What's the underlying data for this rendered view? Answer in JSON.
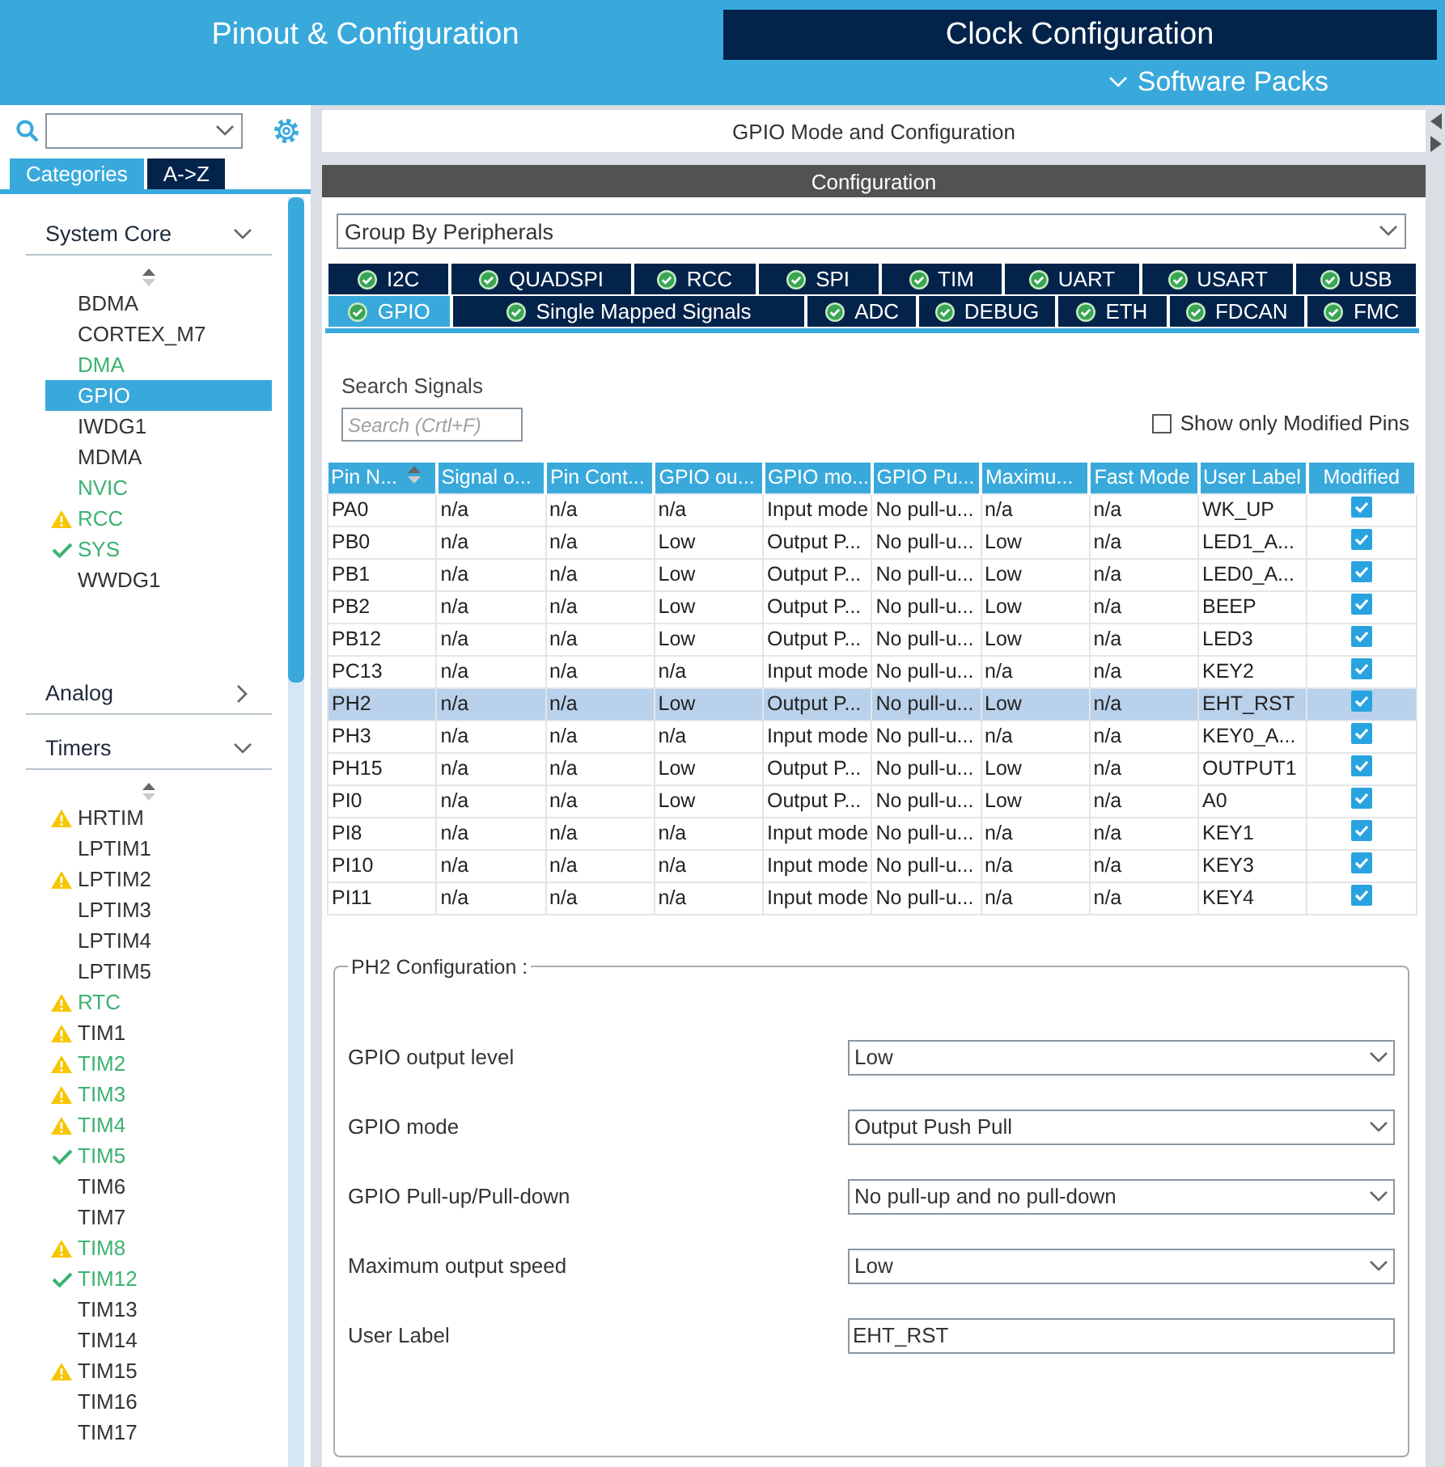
{
  "header": {
    "tabs": [
      {
        "label": "Pinout & Configuration",
        "selected": true
      },
      {
        "label": "Clock Configuration",
        "selected": false
      }
    ],
    "software_packs": "Software Packs"
  },
  "sidebar": {
    "tabs": [
      {
        "label": "Categories",
        "selected": true
      },
      {
        "label": "A->Z",
        "selected": false
      }
    ],
    "sections": [
      {
        "title": "System Core",
        "expanded": true,
        "items": [
          {
            "label": "BDMA",
            "kind": "plain",
            "configured": false,
            "selected": false
          },
          {
            "label": "CORTEX_M7",
            "kind": "plain",
            "configured": false,
            "selected": false
          },
          {
            "label": "DMA",
            "kind": "plain",
            "configured": true,
            "selected": false
          },
          {
            "label": "GPIO",
            "kind": "plain",
            "configured": true,
            "selected": true
          },
          {
            "label": "IWDG1",
            "kind": "plain",
            "configured": false,
            "selected": false
          },
          {
            "label": "MDMA",
            "kind": "plain",
            "configured": false,
            "selected": false
          },
          {
            "label": "NVIC",
            "kind": "plain",
            "configured": true,
            "selected": false
          },
          {
            "label": "RCC",
            "kind": "warning",
            "configured": true,
            "selected": false
          },
          {
            "label": "SYS",
            "kind": "ok",
            "configured": true,
            "selected": false
          },
          {
            "label": "WWDG1",
            "kind": "plain",
            "configured": false,
            "selected": false
          }
        ]
      },
      {
        "title": "Analog",
        "expanded": false
      },
      {
        "title": "Timers",
        "expanded": true,
        "items": [
          {
            "label": "HRTIM",
            "kind": "warning",
            "configured": false,
            "selected": false
          },
          {
            "label": "LPTIM1",
            "kind": "plain",
            "configured": false,
            "selected": false
          },
          {
            "label": "LPTIM2",
            "kind": "warning",
            "configured": false,
            "selected": false
          },
          {
            "label": "LPTIM3",
            "kind": "plain",
            "configured": false,
            "selected": false
          },
          {
            "label": "LPTIM4",
            "kind": "plain",
            "configured": false,
            "selected": false
          },
          {
            "label": "LPTIM5",
            "kind": "plain",
            "configured": false,
            "selected": false
          },
          {
            "label": "RTC",
            "kind": "warning",
            "configured": true,
            "selected": false
          },
          {
            "label": "TIM1",
            "kind": "warning",
            "configured": false,
            "selected": false
          },
          {
            "label": "TIM2",
            "kind": "warning",
            "configured": true,
            "selected": false
          },
          {
            "label": "TIM3",
            "kind": "warning",
            "configured": true,
            "selected": false
          },
          {
            "label": "TIM4",
            "kind": "warning",
            "configured": true,
            "selected": false
          },
          {
            "label": "TIM5",
            "kind": "ok",
            "configured": true,
            "selected": false
          },
          {
            "label": "TIM6",
            "kind": "plain",
            "configured": false,
            "selected": false
          },
          {
            "label": "TIM7",
            "kind": "plain",
            "configured": false,
            "selected": false
          },
          {
            "label": "TIM8",
            "kind": "warning",
            "configured": true,
            "selected": false
          },
          {
            "label": "TIM12",
            "kind": "ok",
            "configured": true,
            "selected": false
          },
          {
            "label": "TIM13",
            "kind": "plain",
            "configured": false,
            "selected": false
          },
          {
            "label": "TIM14",
            "kind": "plain",
            "configured": false,
            "selected": false
          },
          {
            "label": "TIM15",
            "kind": "warning",
            "configured": false,
            "selected": false
          },
          {
            "label": "TIM16",
            "kind": "plain",
            "configured": false,
            "selected": false
          },
          {
            "label": "TIM17",
            "kind": "plain",
            "configured": false,
            "selected": false
          }
        ]
      }
    ]
  },
  "main": {
    "title": "GPIO Mode and Configuration",
    "config_title": "Configuration",
    "group_by": "Group By Peripherals",
    "tab_rows": [
      [
        {
          "label": "I2C",
          "selected": false
        },
        {
          "label": "QUADSPI",
          "selected": false
        },
        {
          "label": "RCC",
          "selected": false
        },
        {
          "label": "SPI",
          "selected": false
        },
        {
          "label": "TIM",
          "selected": false
        },
        {
          "label": "UART",
          "selected": false
        },
        {
          "label": "USART",
          "selected": false
        },
        {
          "label": "USB",
          "selected": false
        }
      ],
      [
        {
          "label": "GPIO",
          "selected": true
        },
        {
          "label": "Single Mapped Signals",
          "selected": false
        },
        {
          "label": "ADC",
          "selected": false
        },
        {
          "label": "DEBUG",
          "selected": false
        },
        {
          "label": "ETH",
          "selected": false
        },
        {
          "label": "FDCAN",
          "selected": false
        },
        {
          "label": "FMC",
          "selected": false
        }
      ]
    ],
    "search_label": "Search Signals",
    "search": {
      "placeholder": "Search (Crtl+F)"
    },
    "show_modified": {
      "label": "Show only Modified Pins",
      "checked": false
    },
    "table": {
      "columns": [
        "Pin N...",
        "Signal o...",
        "Pin Cont...",
        "GPIO ou...",
        "GPIO mo...",
        "GPIO Pu...",
        "Maximu...",
        "Fast Mode",
        "User Label",
        "Modified"
      ],
      "rows": [
        {
          "cells": [
            "PA0",
            "n/a",
            "n/a",
            "n/a",
            "Input mode",
            "No pull-u...",
            "n/a",
            "n/a",
            "WK_UP"
          ],
          "modified": true,
          "selected": false
        },
        {
          "cells": [
            "PB0",
            "n/a",
            "n/a",
            "Low",
            "Output P...",
            "No pull-u...",
            "Low",
            "n/a",
            "LED1_A..."
          ],
          "modified": true,
          "selected": false
        },
        {
          "cells": [
            "PB1",
            "n/a",
            "n/a",
            "Low",
            "Output P...",
            "No pull-u...",
            "Low",
            "n/a",
            "LED0_A..."
          ],
          "modified": true,
          "selected": false
        },
        {
          "cells": [
            "PB2",
            "n/a",
            "n/a",
            "Low",
            "Output P...",
            "No pull-u...",
            "Low",
            "n/a",
            "BEEP"
          ],
          "modified": true,
          "selected": false
        },
        {
          "cells": [
            "PB12",
            "n/a",
            "n/a",
            "Low",
            "Output P...",
            "No pull-u...",
            "Low",
            "n/a",
            "LED3"
          ],
          "modified": true,
          "selected": false
        },
        {
          "cells": [
            "PC13",
            "n/a",
            "n/a",
            "n/a",
            "Input mode",
            "No pull-u...",
            "n/a",
            "n/a",
            "KEY2"
          ],
          "modified": true,
          "selected": false
        },
        {
          "cells": [
            "PH2",
            "n/a",
            "n/a",
            "Low",
            "Output P...",
            "No pull-u...",
            "Low",
            "n/a",
            "EHT_RST"
          ],
          "modified": true,
          "selected": true
        },
        {
          "cells": [
            "PH3",
            "n/a",
            "n/a",
            "n/a",
            "Input mode",
            "No pull-u...",
            "n/a",
            "n/a",
            "KEY0_A..."
          ],
          "modified": true,
          "selected": false
        },
        {
          "cells": [
            "PH15",
            "n/a",
            "n/a",
            "Low",
            "Output P...",
            "No pull-u...",
            "Low",
            "n/a",
            "OUTPUT1"
          ],
          "modified": true,
          "selected": false
        },
        {
          "cells": [
            "PI0",
            "n/a",
            "n/a",
            "Low",
            "Output P...",
            "No pull-u...",
            "Low",
            "n/a",
            "A0"
          ],
          "modified": true,
          "selected": false
        },
        {
          "cells": [
            "PI8",
            "n/a",
            "n/a",
            "n/a",
            "Input mode",
            "No pull-u...",
            "n/a",
            "n/a",
            "KEY1"
          ],
          "modified": true,
          "selected": false
        },
        {
          "cells": [
            "PI10",
            "n/a",
            "n/a",
            "n/a",
            "Input mode",
            "No pull-u...",
            "n/a",
            "n/a",
            "KEY3"
          ],
          "modified": true,
          "selected": false
        },
        {
          "cells": [
            "PI11",
            "n/a",
            "n/a",
            "n/a",
            "Input mode",
            "No pull-u...",
            "n/a",
            "n/a",
            "KEY4"
          ],
          "modified": true,
          "selected": false
        }
      ]
    },
    "pin_config": {
      "title": "PH2 Configuration :",
      "fields": [
        {
          "label": "GPIO output level",
          "kind": "select",
          "value": "Low"
        },
        {
          "label": "GPIO mode",
          "kind": "select",
          "value": "Output Push Pull"
        },
        {
          "label": "GPIO Pull-up/Pull-down",
          "kind": "select",
          "value": "No pull-up and no pull-down"
        },
        {
          "label": "Maximum output speed",
          "kind": "select",
          "value": "Low"
        },
        {
          "label": "User Label",
          "kind": "text",
          "value": "EHT_RST"
        }
      ]
    }
  }
}
